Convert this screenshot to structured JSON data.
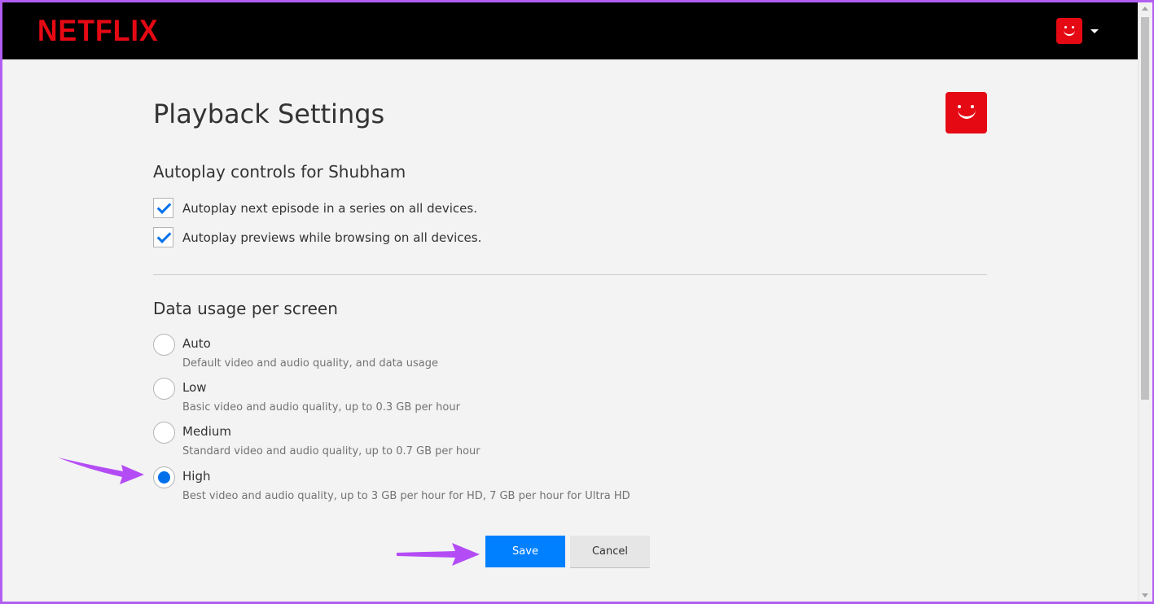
{
  "header": {
    "brand": "NETFLIX",
    "brand_color": "#e50914",
    "profile_icon": "profile-avatar-icon",
    "menu_icon": "caret-down-icon"
  },
  "page": {
    "title": "Playback Settings"
  },
  "autoplay": {
    "heading": "Autoplay controls for Shubham",
    "options": [
      {
        "label": "Autoplay next episode in a series on all devices.",
        "checked": true
      },
      {
        "label": "Autoplay previews while browsing on all devices.",
        "checked": true
      }
    ]
  },
  "data_usage": {
    "heading": "Data usage per screen",
    "options": [
      {
        "label": "Auto",
        "description": "Default video and audio quality, and data usage",
        "selected": false
      },
      {
        "label": "Low",
        "description": "Basic video and audio quality, up to 0.3 GB per hour",
        "selected": false
      },
      {
        "label": "Medium",
        "description": "Standard video and audio quality, up to 0.7 GB per hour",
        "selected": false
      },
      {
        "label": "High",
        "description": "Best video and audio quality, up to 3 GB per hour for HD, 7 GB per hour for Ultra HD",
        "selected": true
      }
    ]
  },
  "actions": {
    "save_label": "Save",
    "cancel_label": "Cancel",
    "save_color": "#0080ff"
  },
  "annotations": {
    "arrow_color": "#b44cf5"
  }
}
